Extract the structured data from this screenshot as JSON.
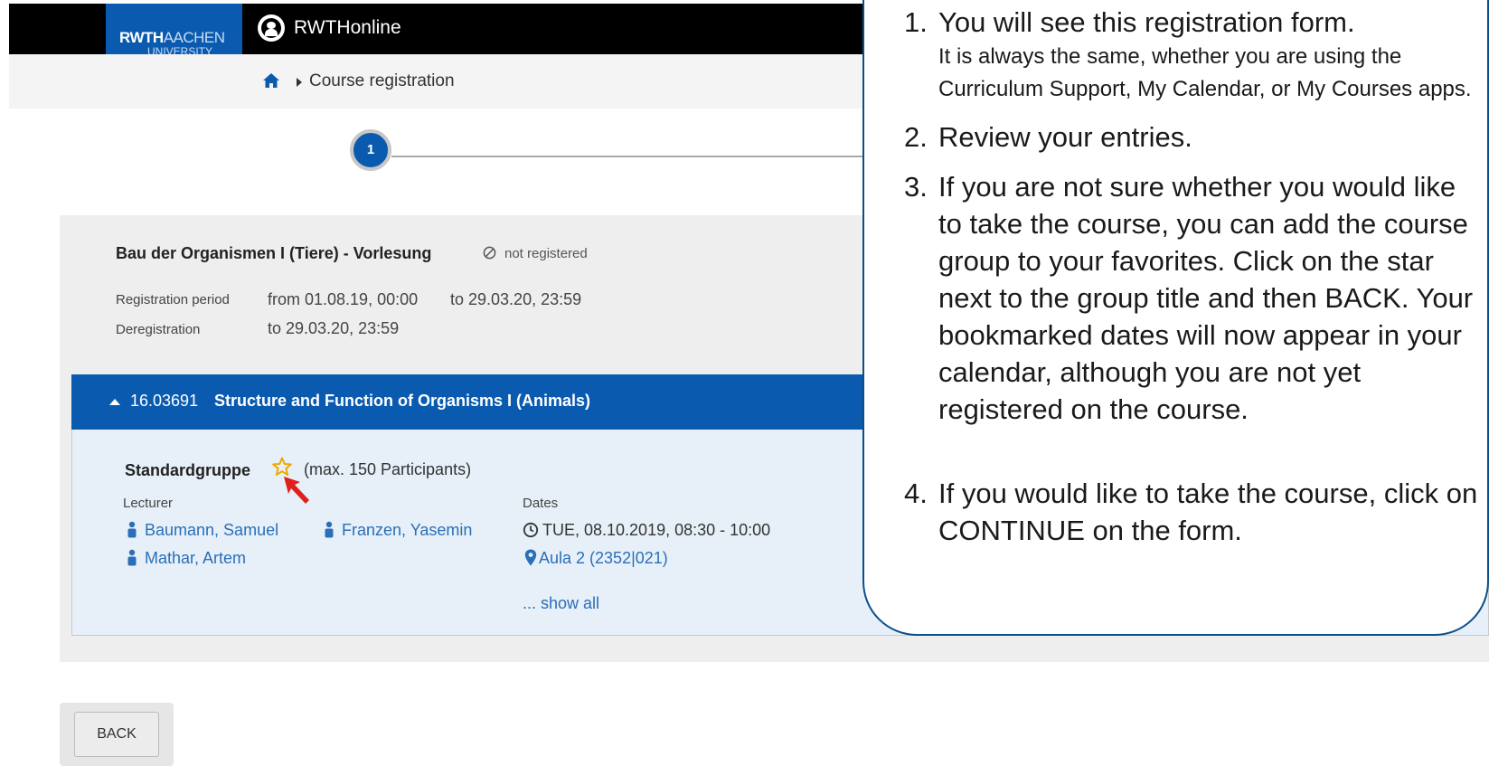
{
  "header": {
    "logo_main": "RWTH",
    "logo_suffix": "AACHEN",
    "logo_line2": "UNIVERSITY",
    "app_title": "RWTHonline"
  },
  "breadcrumb": {
    "current": "Course registration"
  },
  "stepper": {
    "current_step": "1"
  },
  "course": {
    "title": "Bau der Organismen I (Tiere) - Vorlesung",
    "status": "not registered",
    "registration_label": "Registration period",
    "registration_from": "from 01.08.19, 00:00",
    "registration_to": "to 29.03.20, 23:59",
    "deregistration_label": "Deregistration",
    "deregistration_to": "to 29.03.20, 23:59"
  },
  "group": {
    "course_number": "16.03691",
    "course_name": "Structure and Function of Organisms I (Animals)",
    "name": "Standardgruppe",
    "max_participants": "(max. 150 Participants)",
    "lecturer_label": "Lecturer",
    "dates_label": "Dates",
    "lecturers": [
      "Baumann, Samuel",
      "Franzen, Yasemin",
      "Mathar, Artem"
    ],
    "date": "TUE, 08.10.2019, 08:30 - 10:00",
    "room": "Aula 2 (2352|021)",
    "show_all": "... show all"
  },
  "actions": {
    "back_label": "BACK"
  },
  "callout": {
    "items": [
      {
        "num": "1.",
        "main": "You will see this registration form.",
        "sub": "It is always the same, whether you are using the Curriculum Support, My Calendar, or My Courses apps."
      },
      {
        "num": "2.",
        "main": "Review your entries."
      },
      {
        "num": "3.",
        "main": "If you are not sure whether you would like to take the course, you can add the course group to your favorites. Click on the star next to the group title and then BACK. Your bookmarked dates will now appear in your calendar, although you are not yet registered on the course."
      },
      {
        "num": "4.",
        "main": "If you would like to take the course, click on CONTINUE on the form."
      }
    ]
  },
  "colors": {
    "brand_blue": "#0a5bb0",
    "link_blue": "#2a6fb8",
    "star": "#f0a800",
    "pointer_red": "#e0201b"
  }
}
